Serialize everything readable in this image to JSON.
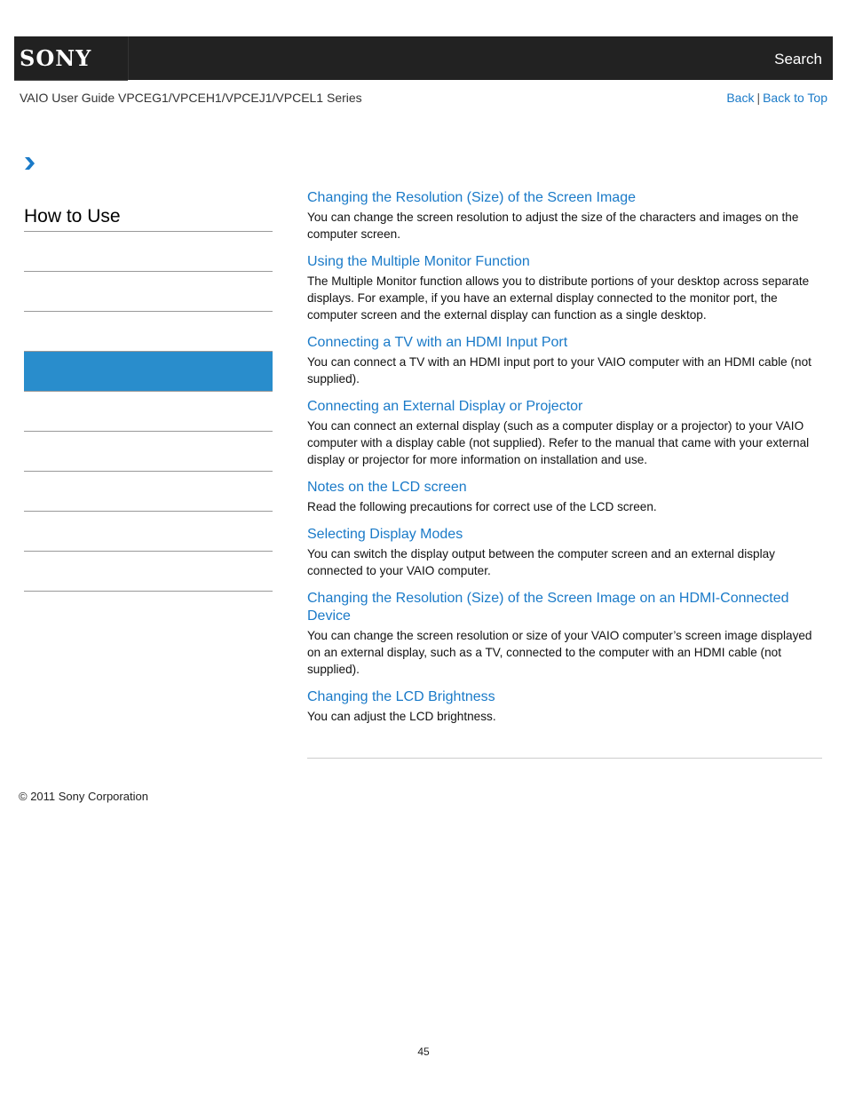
{
  "header": {
    "logo": "SONY",
    "search_label": "Search"
  },
  "subheader": {
    "guide_title": "VAIO User Guide VPCEG1/VPCEH1/VPCEJ1/VPCEL1 Series",
    "back_label": "Back",
    "separator": "|",
    "back_to_top_label": "Back to Top"
  },
  "breadcrumb": {
    "icon": "chevron-right-icon"
  },
  "sidebar": {
    "heading": "How to Use",
    "active_index": 3,
    "item_count": 10
  },
  "topics": [
    {
      "title": "Changing the Resolution (Size) of the Screen Image",
      "description": "You can change the screen resolution to adjust the size of the characters and images on the computer screen."
    },
    {
      "title": "Using the Multiple Monitor Function",
      "description": "The Multiple Monitor function allows you to distribute portions of your desktop across separate displays. For example, if you have an external display connected to the monitor port, the computer screen and the external display can function as a single desktop."
    },
    {
      "title": "Connecting a TV with an HDMI Input Port",
      "description": "You can connect a TV with an HDMI input port to your VAIO computer with an HDMI cable (not supplied)."
    },
    {
      "title": "Connecting an External Display or Projector",
      "description": "You can connect an external display (such as a computer display or a projector) to your VAIO computer with a display cable (not supplied). Refer to the manual that came with your external display or projector for more information on installation and use."
    },
    {
      "title": "Notes on the LCD screen",
      "description": "Read the following precautions for correct use of the LCD screen."
    },
    {
      "title": "Selecting Display Modes",
      "description": "You can switch the display output between the computer screen and an external display connected to your VAIO computer."
    },
    {
      "title": "Changing the Resolution (Size) of the Screen Image on an HDMI-Connected Device",
      "description": "You can change the screen resolution or size of your VAIO computer’s screen image displayed on an external display, such as a TV, connected to the computer with an HDMI cable (not supplied)."
    },
    {
      "title": "Changing the LCD Brightness",
      "description": "You can adjust the LCD brightness."
    }
  ],
  "footer": {
    "copyright": "© 2011 Sony Corporation",
    "page_number": "45"
  },
  "colors": {
    "header_bg": "#222222",
    "link": "#1a7ac8",
    "sidebar_active": "#298dcc"
  }
}
